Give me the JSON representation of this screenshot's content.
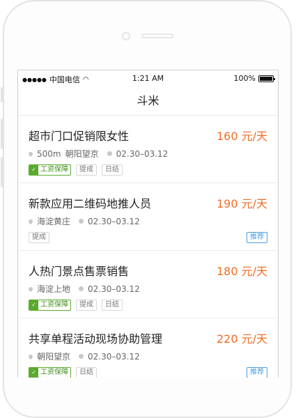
{
  "status": {
    "carrier": "中国电信",
    "time": "1:21 AM",
    "battery": "100%"
  },
  "nav": {
    "title": "斗米"
  },
  "jobs": [
    {
      "title": "超市门口促销限女性",
      "price": "160 元/天",
      "distance": "500m",
      "location": "朝阳望京",
      "dates": "02.30–03.12",
      "guarantee": "工资保障",
      "tags": [
        "提成",
        "日结"
      ],
      "recommend": ""
    },
    {
      "title": "新款应用二维码地推人员",
      "price": "190 元/天",
      "distance": "",
      "location": "海淀黄庄",
      "dates": "02.30–03.12",
      "guarantee": "",
      "tags": [
        "提成"
      ],
      "recommend": "推荐"
    },
    {
      "title": "人热门景点售票销售",
      "price": "180 元/天",
      "distance": "",
      "location": "海淀上地",
      "dates": "02.30–03.12",
      "guarantee": "工资保障",
      "tags": [
        "提成",
        "日结"
      ],
      "recommend": ""
    },
    {
      "title": "共享单程活动现场协助管理",
      "price": "220 元/天",
      "distance": "",
      "location": "朝阳望京",
      "dates": "02.30–03.12",
      "guarantee": "工资保障",
      "tags": [
        "日结"
      ],
      "recommend": "推荐"
    }
  ],
  "colors": {
    "price": "#f36b24",
    "guarantee": "#5aaa2e",
    "recommend": "#4a9de8"
  }
}
